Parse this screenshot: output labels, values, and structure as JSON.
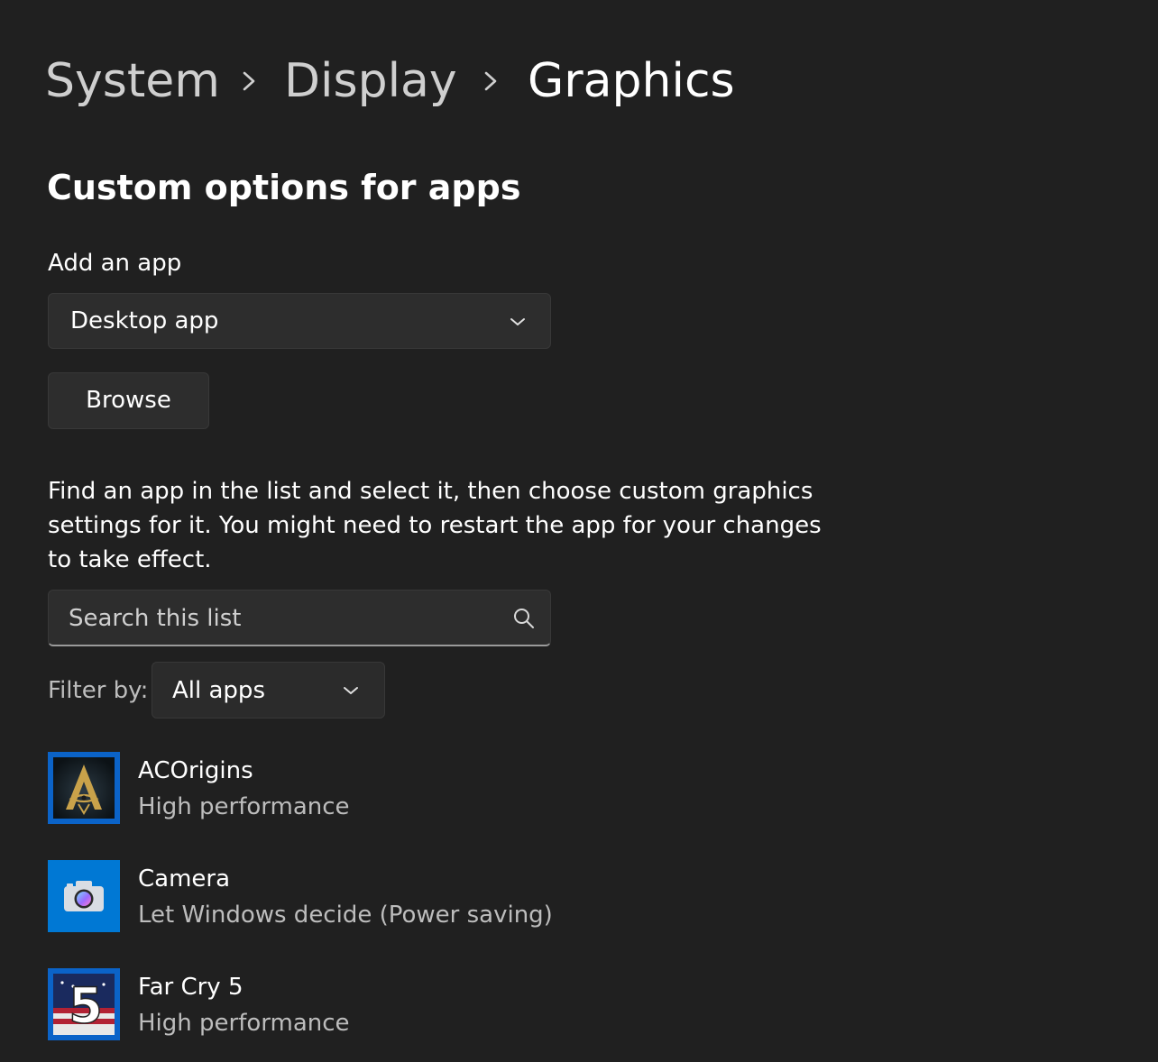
{
  "breadcrumb": {
    "items": [
      "System",
      "Display",
      "Graphics"
    ]
  },
  "section": {
    "title": "Custom options for apps"
  },
  "add_app": {
    "label": "Add an app",
    "selected": "Desktop app",
    "browse_label": "Browse"
  },
  "description": "Find an app in the list and select it, then choose custom graphics settings for it. You might need to restart the app for your changes to take effect.",
  "search": {
    "placeholder": "Search this list",
    "value": ""
  },
  "filter": {
    "label": "Filter by:",
    "selected": "All apps"
  },
  "apps": [
    {
      "name": "ACOrigins",
      "setting": "High performance",
      "icon": "assassins-creed-icon"
    },
    {
      "name": "Camera",
      "setting": "Let Windows decide (Power saving)",
      "icon": "camera-icon"
    },
    {
      "name": "Far Cry 5",
      "setting": "High performance",
      "icon": "far-cry-5-icon",
      "icon_text": "5"
    }
  ],
  "colors": {
    "background": "#202020",
    "control": "#2d2d2d",
    "accent_blue": "#0078d4",
    "secondary_text": "#bdbdbd"
  }
}
